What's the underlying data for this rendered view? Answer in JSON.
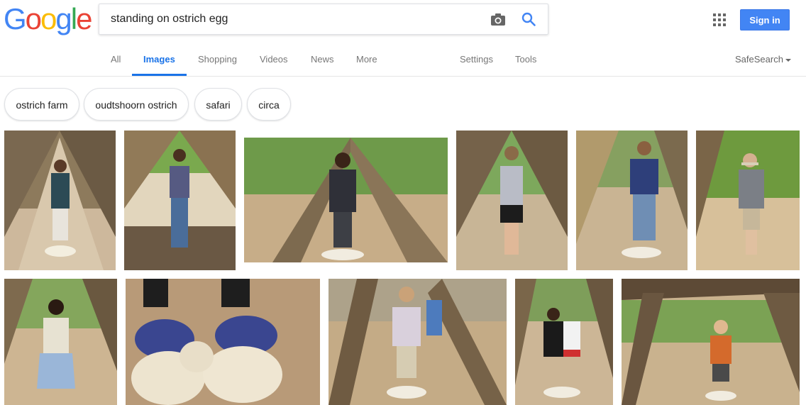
{
  "logo": {
    "letters": [
      "G",
      "o",
      "o",
      "g",
      "l",
      "e"
    ],
    "colors": [
      "#4285f4",
      "#ea4335",
      "#fbbc05",
      "#4285f4",
      "#34a853",
      "#ea4335"
    ]
  },
  "search": {
    "value": "standing on ostrich egg"
  },
  "header": {
    "sign_in": "Sign in"
  },
  "tabs": {
    "all": "All",
    "images": "Images",
    "shopping": "Shopping",
    "videos": "Videos",
    "news": "News",
    "more": "More",
    "settings": "Settings",
    "tools": "Tools",
    "safesearch": "SafeSearch"
  },
  "chips": [
    "ostrich farm",
    "oudtshoorn ostrich",
    "safari",
    "circa"
  ],
  "colors": {
    "accent": "#1a73e8",
    "sign_in_bg": "#4285f4"
  }
}
